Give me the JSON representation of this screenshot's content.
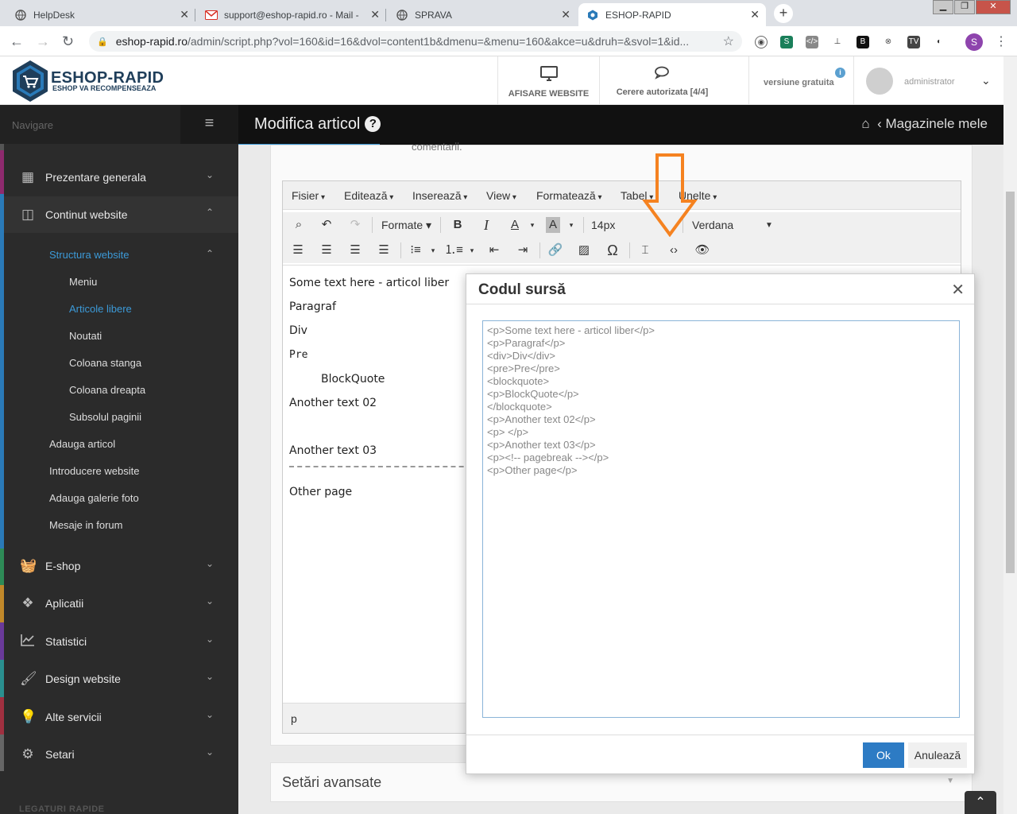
{
  "browser": {
    "tabs": [
      {
        "title": "HelpDesk",
        "icon": "globe-icon"
      },
      {
        "title": "support@eshop-rapid.ro - Mail -",
        "icon": "mail-icon"
      },
      {
        "title": "SPRAVA",
        "icon": "globe-icon"
      },
      {
        "title": "ESHOP-RAPID",
        "icon": "eshop-hex-icon",
        "active": true
      }
    ],
    "url_host": "eshop-rapid.ro",
    "url_rest": "/admin/script.php?vol=160&id=16&dvol=content1b&dmenu=&menu=160&akce=u&druh=&svol=1&id...",
    "profile_initial": "S"
  },
  "header": {
    "logo_title": "ESHOP-RAPID",
    "logo_subtitle": "ESHOP VA RECOMPENSEAZA",
    "afisare_label": "AFISARE WEBSITE",
    "cerere_label": "Cerere autorizata [4/4]",
    "versiune_label": "versiune gratuita",
    "user_name": "administrator"
  },
  "sidebar": {
    "nav_label": "Navigare",
    "items": [
      {
        "label": "Prezentare generala",
        "icon": "grid-icon",
        "color": "#8e2a6e"
      },
      {
        "label": "Continut website",
        "icon": "layout-icon",
        "color": "#2a7ab8"
      },
      {
        "label": "E-shop",
        "icon": "basket-icon",
        "color": "#2e8b57"
      },
      {
        "label": "Aplicatii",
        "icon": "cubes-icon",
        "color": "#c0882a"
      },
      {
        "label": "Statistici",
        "icon": "chart-icon",
        "color": "#6a3a9a"
      },
      {
        "label": "Design website",
        "icon": "brush-icon",
        "color": "#2a8f8f"
      },
      {
        "label": "Alte servicii",
        "icon": "bulb-icon",
        "color": "#a03040"
      },
      {
        "label": "Setari",
        "icon": "cogs-icon",
        "color": "#666666"
      }
    ],
    "structura_label": "Structura website",
    "structura_sub": [
      "Meniu",
      "Articole libere",
      "Noutati",
      "Coloana stanga",
      "Coloana dreapta",
      "Subsolul paginii"
    ],
    "continut_sub": [
      "Adauga articol",
      "Introducere website",
      "Adauga galerie foto",
      "Mesaje in forum"
    ],
    "quick_links": "LEGATURI RAPIDE"
  },
  "page": {
    "title": "Modifica articol",
    "breadcrumb": "Magazinele mele",
    "comentarii_text": "comentarii.",
    "setari_avansate": "Setări avansate"
  },
  "editor": {
    "menus": [
      "Fisier",
      "Editează",
      "Inserează",
      "View",
      "Formatează",
      "Tabel",
      "Unelte"
    ],
    "formats_label": "Formate",
    "font_size": "14px",
    "font_family": "Verdana",
    "content": {
      "p1": "Some text here - articol liber",
      "p2": "Paragraf",
      "div": "Div",
      "pre": "Pre",
      "blockquote": "BlockQuote",
      "p3": "Another text 02",
      "p4": "Another text 03",
      "p5": "Other page"
    },
    "status_path": "p"
  },
  "modal": {
    "title": "Codul sursă",
    "source_code": "<p>Some text here - articol liber</p>\n<p>Paragraf</p>\n<div>Div</div>\n<pre>Pre</pre>\n<blockquote>\n<p>BlockQuote</p>\n</blockquote>\n<p>Another text 02</p>\n<p> </p>\n<p>Another text 03</p>\n<p><!-- pagebreak --></p>\n<p>Other page</p>",
    "ok_label": "Ok",
    "cancel_label": "Anulează"
  },
  "colors": {
    "accent": "#3c9ad8",
    "annotation_arrow": "#f58220",
    "ok_button": "#2d7bc4"
  }
}
